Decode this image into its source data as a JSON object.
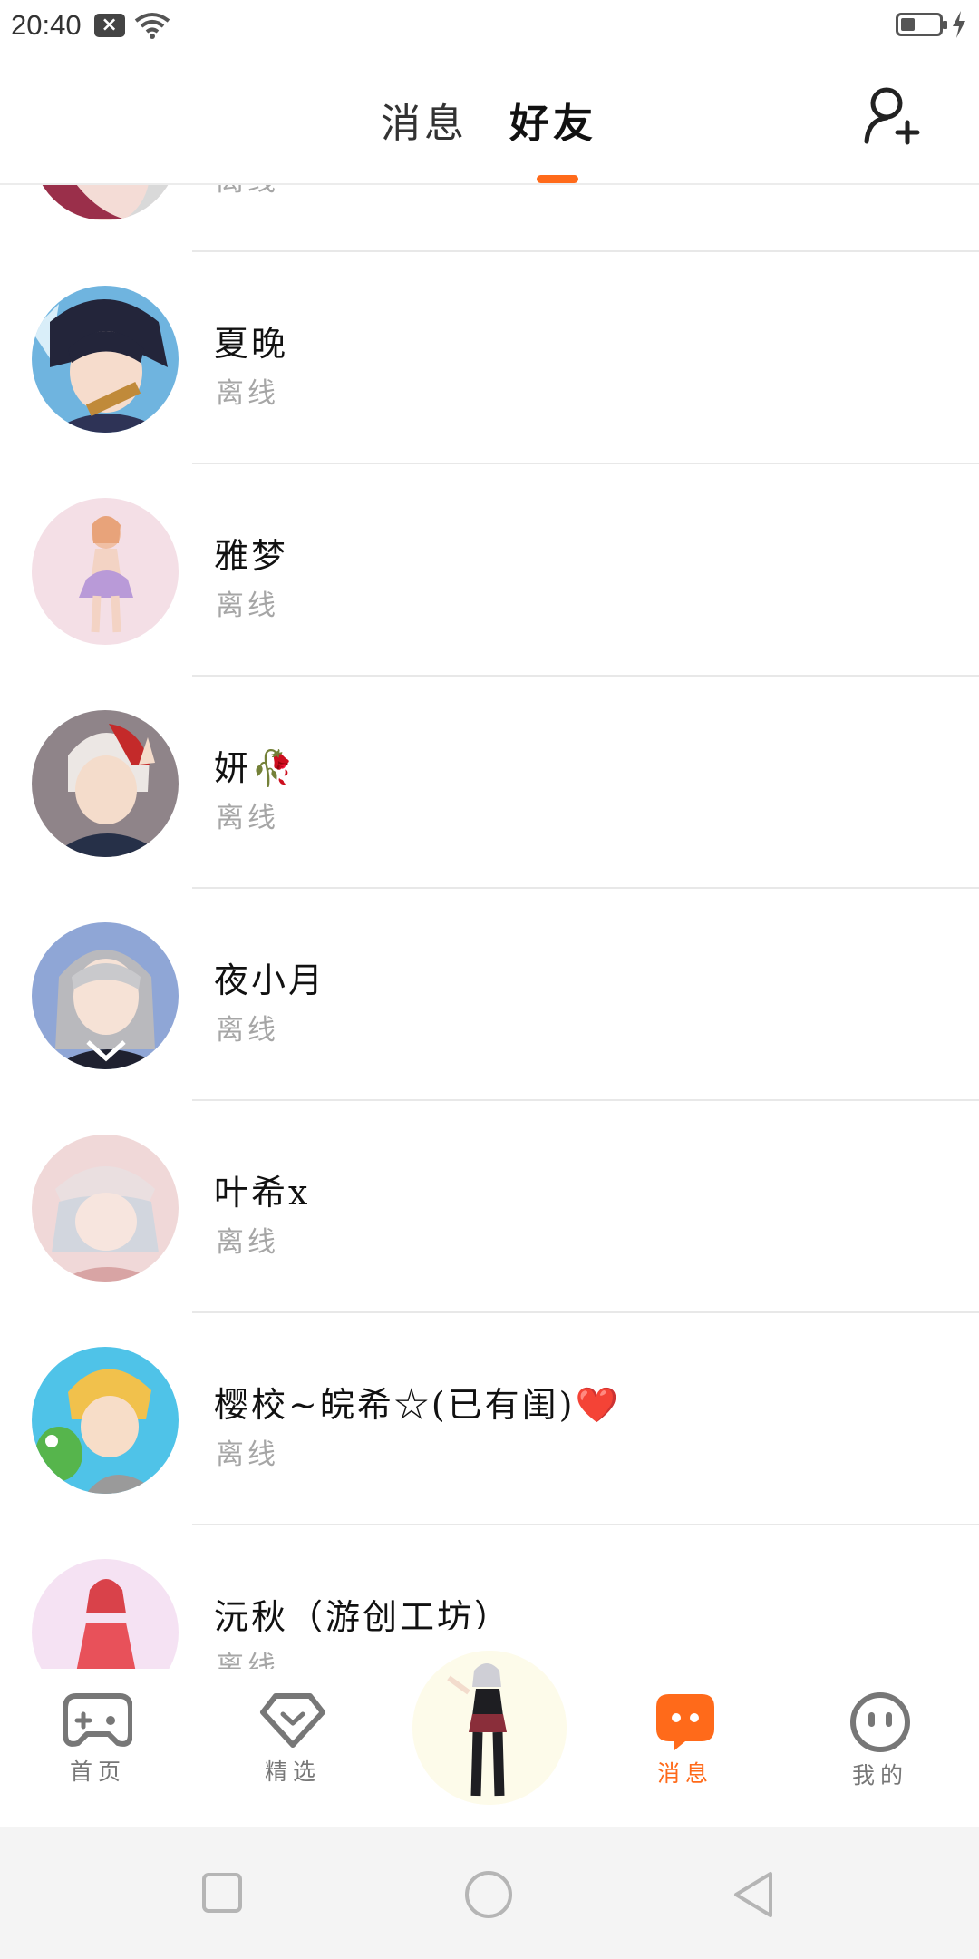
{
  "status_bar": {
    "time": "20:40",
    "notification_icon": "close-box-icon",
    "wifi_icon": "wifi-icon",
    "battery_icon": "battery-low-icon",
    "charging_icon": "bolt-icon"
  },
  "header": {
    "tabs": [
      {
        "label": "消息",
        "active": false
      },
      {
        "label": "好友",
        "active": true
      }
    ],
    "add_friend_icon": "add-user-icon",
    "accent_color": "#ff6a1a"
  },
  "friends": [
    {
      "name": "",
      "status": "离线"
    },
    {
      "name": "夏晚",
      "status": "离线"
    },
    {
      "name": "雅梦",
      "status": "离线"
    },
    {
      "name": "妍🥀",
      "status": "离线"
    },
    {
      "name": "夜小月",
      "status": "离线"
    },
    {
      "name": "叶希x",
      "status": "离线"
    },
    {
      "name": "樱校~皖希☆(已有闺)❤️",
      "status": "离线"
    },
    {
      "name": "沅秋（游创工坊）",
      "status": "离线"
    }
  ],
  "bottom_nav": {
    "items": [
      {
        "label": "首页",
        "icon": "gamepad-icon",
        "active": false
      },
      {
        "label": "精选",
        "icon": "heart-badge-icon",
        "active": false
      },
      {
        "label": "",
        "icon": "character-avatar",
        "active": false
      },
      {
        "label": "消息",
        "icon": "chat-bubble-icon",
        "active": true
      },
      {
        "label": "我的",
        "icon": "face-icon",
        "active": false
      }
    ]
  },
  "system_nav": {
    "recent": "square-icon",
    "home": "circle-icon",
    "back": "triangle-back-icon"
  }
}
